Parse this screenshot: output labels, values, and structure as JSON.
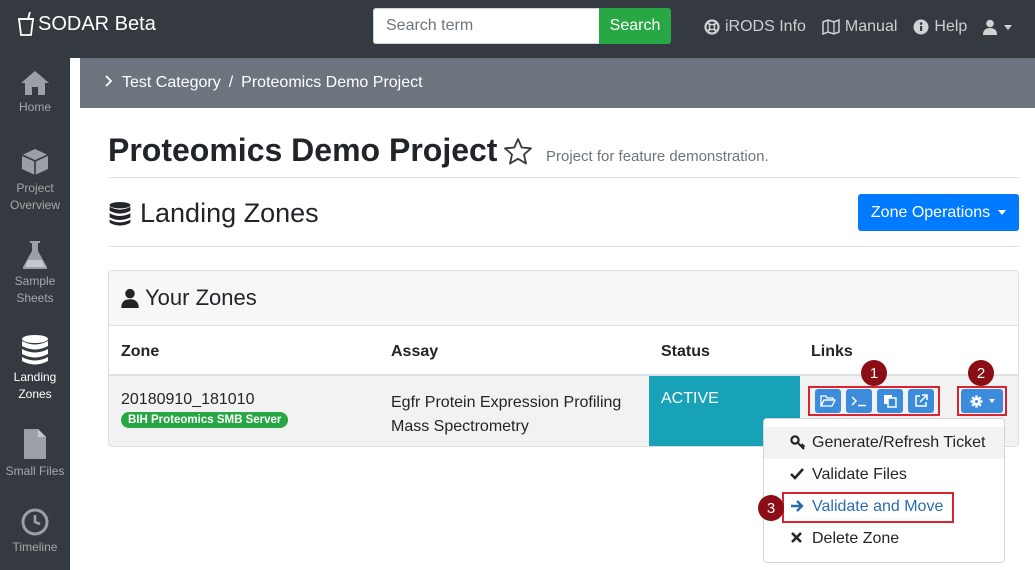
{
  "app": {
    "brand": "SODAR Beta"
  },
  "search": {
    "placeholder": "Search term",
    "button": "Search"
  },
  "nav": {
    "irods": "iRODS Info",
    "manual": "Manual",
    "help": "Help"
  },
  "sidebar": {
    "items": [
      {
        "label": "Home",
        "icon": "home-icon"
      },
      {
        "label": "Project Overview",
        "icon": "cube-icon"
      },
      {
        "label": "Sample Sheets",
        "icon": "flask-icon"
      },
      {
        "label": "Landing Zones",
        "icon": "database-icon"
      },
      {
        "label": "Small Files",
        "icon": "file-icon"
      },
      {
        "label": "Timeline",
        "icon": "clock-icon"
      }
    ]
  },
  "breadcrumb": {
    "category": "Test Category",
    "sep": "/",
    "project": "Proteomics Demo Project"
  },
  "page": {
    "title": "Proteomics Demo Project",
    "description": "Project for feature demonstration.",
    "section_title": "Landing Zones",
    "zone_operations": "Zone Operations"
  },
  "zones": {
    "card_title": "Your Zones",
    "columns": [
      "Zone",
      "Assay",
      "Status",
      "Links"
    ],
    "rows": [
      {
        "zone": "20180910_181010",
        "badge": "BIH Proteomics SMB Server",
        "assay_line1": "Egfr Protein Expression Profiling",
        "assay_line2": "Mass Spectrometry",
        "status": "ACTIVE"
      }
    ]
  },
  "dropdown": {
    "items": [
      {
        "label": "Generate/Refresh Ticket",
        "icon": "key-icon"
      },
      {
        "label": "Validate Files",
        "icon": "check-icon"
      },
      {
        "label": "Validate and Move",
        "icon": "arrow-right-icon"
      },
      {
        "label": "Delete Zone",
        "icon": "times-icon"
      }
    ]
  },
  "markers": [
    "1",
    "2",
    "3"
  ],
  "colors": {
    "navbar": "#343a40",
    "primary": "#007bff",
    "success": "#28a745",
    "info": "#17a2b8",
    "marker": "#8b0d15",
    "highlight_border": "#d9232e"
  }
}
